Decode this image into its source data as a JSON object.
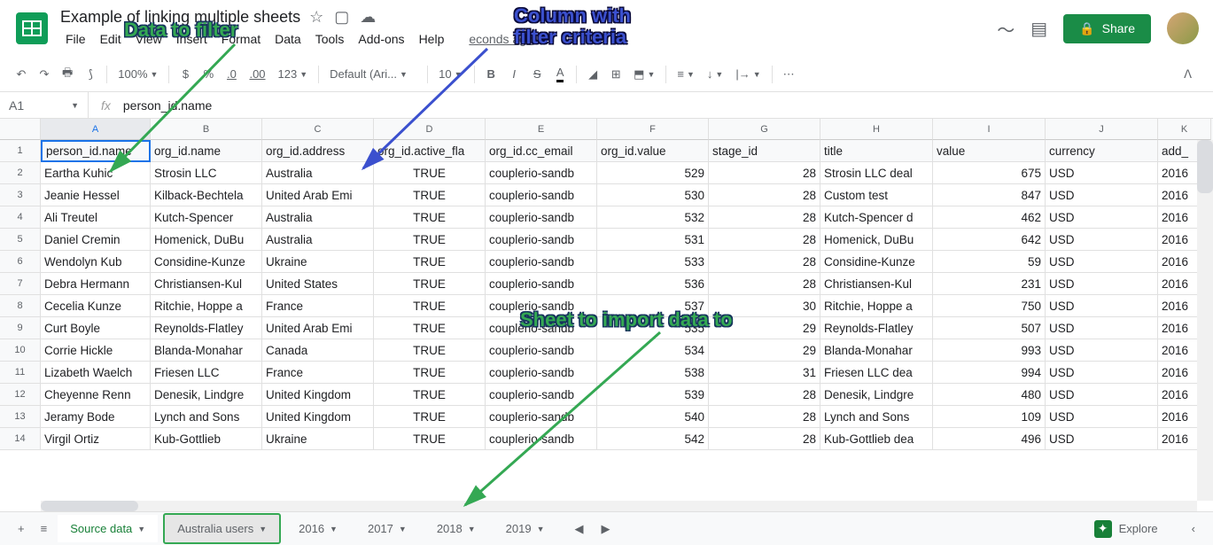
{
  "doc": {
    "title": "Example of linking multiple sheets",
    "last_edit": "econds ago"
  },
  "menus": [
    "File",
    "Edit",
    "View",
    "Insert",
    "Format",
    "Data",
    "Tools",
    "Add-ons",
    "Help"
  ],
  "share_label": "Share",
  "toolbar": {
    "zoom": "100%",
    "currency": "$",
    "percent": "%",
    "dec_dec": ".0",
    "inc_dec": ".00",
    "num_fmt": "123",
    "font": "Default (Ari...",
    "font_size": "10"
  },
  "cell_ref": "A1",
  "formula": "person_id.name",
  "columns": [
    "A",
    "B",
    "C",
    "D",
    "E",
    "F",
    "G",
    "H",
    "I",
    "J",
    "K"
  ],
  "headers": [
    "person_id.name",
    "org_id.name",
    "org_id.address",
    "org_id.active_fla",
    "org_id.cc_email",
    "org_id.value",
    "stage_id",
    "title",
    "value",
    "currency",
    "add_"
  ],
  "rows": [
    [
      "Eartha Kuhic",
      "Strosin LLC",
      "Australia",
      "TRUE",
      "couplerio-sandb",
      "529",
      "28",
      "Strosin LLC deal",
      "675",
      "USD",
      "2016"
    ],
    [
      "Jeanie Hessel",
      "Kilback-Bechtela",
      "United Arab Emi",
      "TRUE",
      "couplerio-sandb",
      "530",
      "28",
      "Custom test",
      "847",
      "USD",
      "2016"
    ],
    [
      "Ali Treutel",
      "Kutch-Spencer",
      "Australia",
      "TRUE",
      "couplerio-sandb",
      "532",
      "28",
      "Kutch-Spencer d",
      "462",
      "USD",
      "2016"
    ],
    [
      "Daniel Cremin",
      "Homenick, DuBu",
      "Australia",
      "TRUE",
      "couplerio-sandb",
      "531",
      "28",
      "Homenick, DuBu",
      "642",
      "USD",
      "2016"
    ],
    [
      "Wendolyn Kub",
      "Considine-Kunze",
      "Ukraine",
      "TRUE",
      "couplerio-sandb",
      "533",
      "28",
      "Considine-Kunze",
      "59",
      "USD",
      "2016"
    ],
    [
      "Debra Hermann",
      "Christiansen-Kul",
      "United States",
      "TRUE",
      "couplerio-sandb",
      "536",
      "28",
      "Christiansen-Kul",
      "231",
      "USD",
      "2016"
    ],
    [
      "Cecelia Kunze",
      "Ritchie, Hoppe a",
      "France",
      "TRUE",
      "couplerio-sandb",
      "537",
      "30",
      "Ritchie, Hoppe a",
      "750",
      "USD",
      "2016"
    ],
    [
      "Curt Boyle",
      "Reynolds-Flatley",
      "United Arab Emi",
      "TRUE",
      "couplerio-sandb",
      "535",
      "29",
      "Reynolds-Flatley",
      "507",
      "USD",
      "2016"
    ],
    [
      "Corrie Hickle",
      "Blanda-Monahar",
      "Canada",
      "TRUE",
      "couplerio-sandb",
      "534",
      "29",
      "Blanda-Monahar",
      "993",
      "USD",
      "2016"
    ],
    [
      "Lizabeth Waelch",
      "Friesen LLC",
      "France",
      "TRUE",
      "couplerio-sandb",
      "538",
      "31",
      "Friesen LLC dea",
      "994",
      "USD",
      "2016"
    ],
    [
      "Cheyenne Renn",
      "Denesik, Lindgre",
      "United Kingdom",
      "TRUE",
      "couplerio-sandb",
      "539",
      "28",
      "Denesik, Lindgre",
      "480",
      "USD",
      "2016"
    ],
    [
      "Jeramy Bode",
      "Lynch and Sons",
      "United Kingdom",
      "TRUE",
      "couplerio-sandb",
      "540",
      "28",
      "Lynch and Sons",
      "109",
      "USD",
      "2016"
    ],
    [
      "Virgil Ortiz",
      "Kub-Gottlieb",
      "Ukraine",
      "TRUE",
      "couplerio-sandb",
      "542",
      "28",
      "Kub-Gottlieb dea",
      "496",
      "USD",
      "2016"
    ]
  ],
  "tabs": [
    {
      "label": "Source data",
      "cls": "active-green"
    },
    {
      "label": "Australia users",
      "cls": "highlighted"
    },
    {
      "label": "2016",
      "cls": ""
    },
    {
      "label": "2017",
      "cls": ""
    },
    {
      "label": "2018",
      "cls": ""
    },
    {
      "label": "2019",
      "cls": ""
    }
  ],
  "explore_label": "Explore",
  "annotations": {
    "a1": "Data to filter",
    "a2": "Column with\nfilter criteria",
    "a3": "Sheet to import data to"
  }
}
